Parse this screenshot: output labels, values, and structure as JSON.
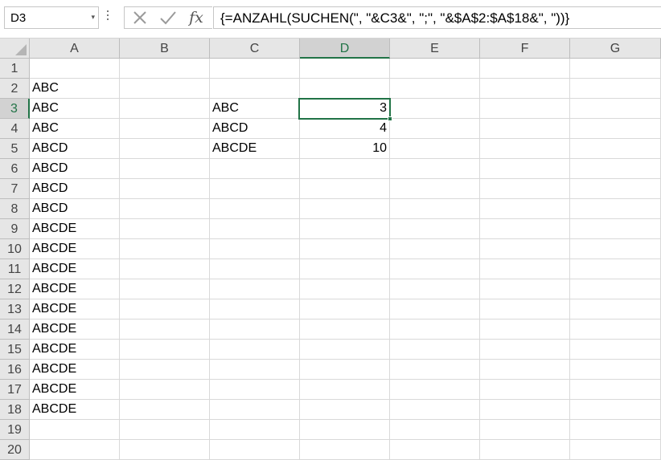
{
  "name_box": {
    "value": "D3",
    "arrow": "▾"
  },
  "formula_bar": {
    "cancel_icon": "close-icon",
    "enter_icon": "checkmark-icon",
    "fx_label": "fx",
    "formula": "{=ANZAHL(SUCHEN(\", \"&C3&\", \";\", \"&$A$2:$A$18&\", \"))}"
  },
  "columns": [
    "A",
    "B",
    "C",
    "D",
    "E",
    "F",
    "G"
  ],
  "active_column": "D",
  "rows": [
    "1",
    "2",
    "3",
    "4",
    "5",
    "6",
    "7",
    "8",
    "9",
    "10",
    "11",
    "12",
    "13",
    "14",
    "15",
    "16",
    "17",
    "18",
    "19",
    "20"
  ],
  "active_row": "3",
  "active_cell": "D3",
  "column_a": [
    "",
    "ABC",
    "ABC",
    "ABC",
    "ABCD",
    "ABCD",
    "ABCD",
    "ABCD",
    "ABCDE",
    "ABCDE",
    "ABCDE",
    "ABCDE",
    "ABCDE",
    "ABCDE",
    "ABCDE",
    "ABCDE",
    "ABCDE",
    "ABCDE",
    "",
    ""
  ],
  "column_c": {
    "3": "ABC",
    "4": "ABCD",
    "5": "ABCDE"
  },
  "column_d": {
    "3": "3",
    "4": "4",
    "5": "10"
  },
  "colors": {
    "accent": "#217346",
    "header_bg": "#e6e6e6",
    "gridline": "#d9d9d9"
  }
}
